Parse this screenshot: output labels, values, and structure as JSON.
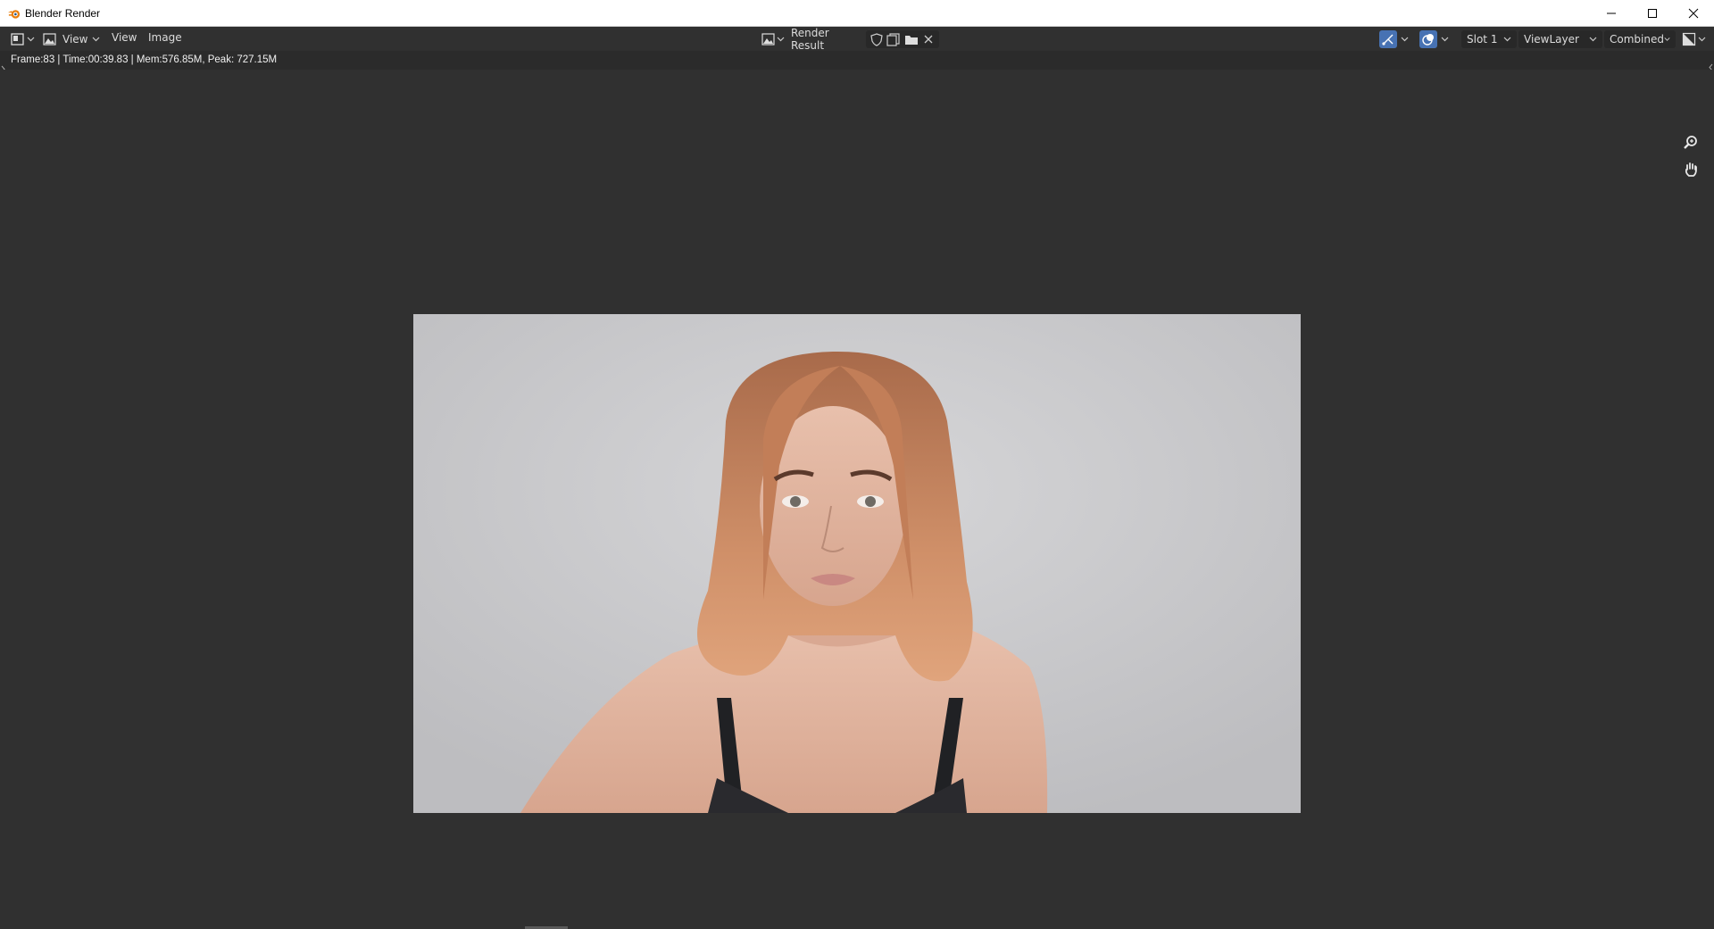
{
  "window": {
    "title": "Blender Render",
    "controls": [
      "minimize-icon",
      "maximize-icon",
      "close-icon"
    ]
  },
  "header": {
    "editor_type_icon": "image-editor-icon",
    "mode_icon": "image-icon",
    "menus": [
      "View",
      "View",
      "Image"
    ],
    "image_browse_icon": "image-browse-icon",
    "image_name": "Render Result",
    "image_actions": [
      "fake-user-shield-icon",
      "new-image-icon",
      "open-folder-icon",
      "close-icon"
    ],
    "right_icons": [
      "gizmo-icon",
      "overlay-icon"
    ],
    "slot": "Slot 1",
    "view_layer": "ViewLayer",
    "pass": "Combined",
    "display_channels_icon": "display-channels-icon"
  },
  "status": {
    "text": "Frame:83 | Time:00:39.83 | Mem:576.85M, Peak: 727.15M"
  },
  "viewport": {
    "render_content": "portrait render of a woman with shoulder-length copper hair against a light grey background",
    "tools": [
      "zoom-icon",
      "hand-pan-icon"
    ]
  },
  "colors": {
    "bg": "#303030",
    "header_bg": "#303030",
    "status_bg": "#2b2b2b",
    "accent_blue": "#4772b3",
    "hair": "#c98a62",
    "skin": "#e6b9a3"
  }
}
